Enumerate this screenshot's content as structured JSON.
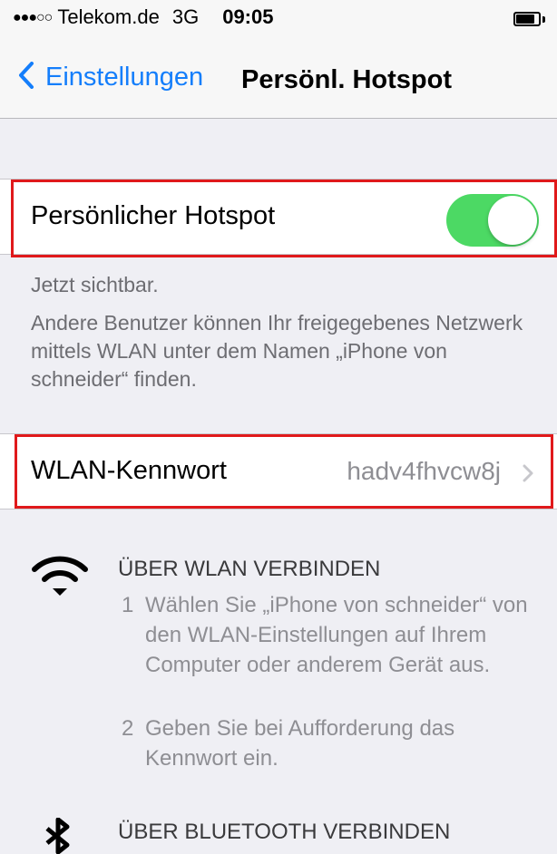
{
  "status_bar": {
    "signal": "●●●○○",
    "carrier": "Telekom.de",
    "network": "3G",
    "time": "09:05",
    "battery_level": 0.85
  },
  "nav": {
    "back_label": "Einstellungen",
    "title": "Persönl. Hotspot"
  },
  "hotspot": {
    "label": "Persönlicher Hotspot",
    "enabled": true,
    "toggle_color": "#4cd964"
  },
  "info": {
    "visible_text": "Jetzt sichtbar.",
    "description": "Andere Benutzer können Ihr freigegebenes Netzwerk mittels WLAN unter dem Namen „iPhone von schneider“ finden."
  },
  "wlan_password": {
    "label": "WLAN-Kennwort",
    "value": "hadv4fhvcw8j"
  },
  "wifi_section": {
    "icon": "wifi-icon",
    "heading": "ÜBER WLAN VERBINDEN",
    "steps": [
      {
        "num": "1",
        "text": "Wählen Sie „iPhone von schneider“ von den WLAN-Einstellungen auf Ihrem Computer oder anderem Gerät aus."
      },
      {
        "num": "2",
        "text": "Geben Sie bei Aufforderung das Kennwort ein."
      }
    ]
  },
  "bluetooth_section": {
    "icon": "bluetooth-icon",
    "heading": "ÜBER BLUETOOTH VERBINDEN"
  },
  "colors": {
    "accent": "#147efb",
    "highlight": "#e0191b",
    "background": "#efeff4"
  }
}
